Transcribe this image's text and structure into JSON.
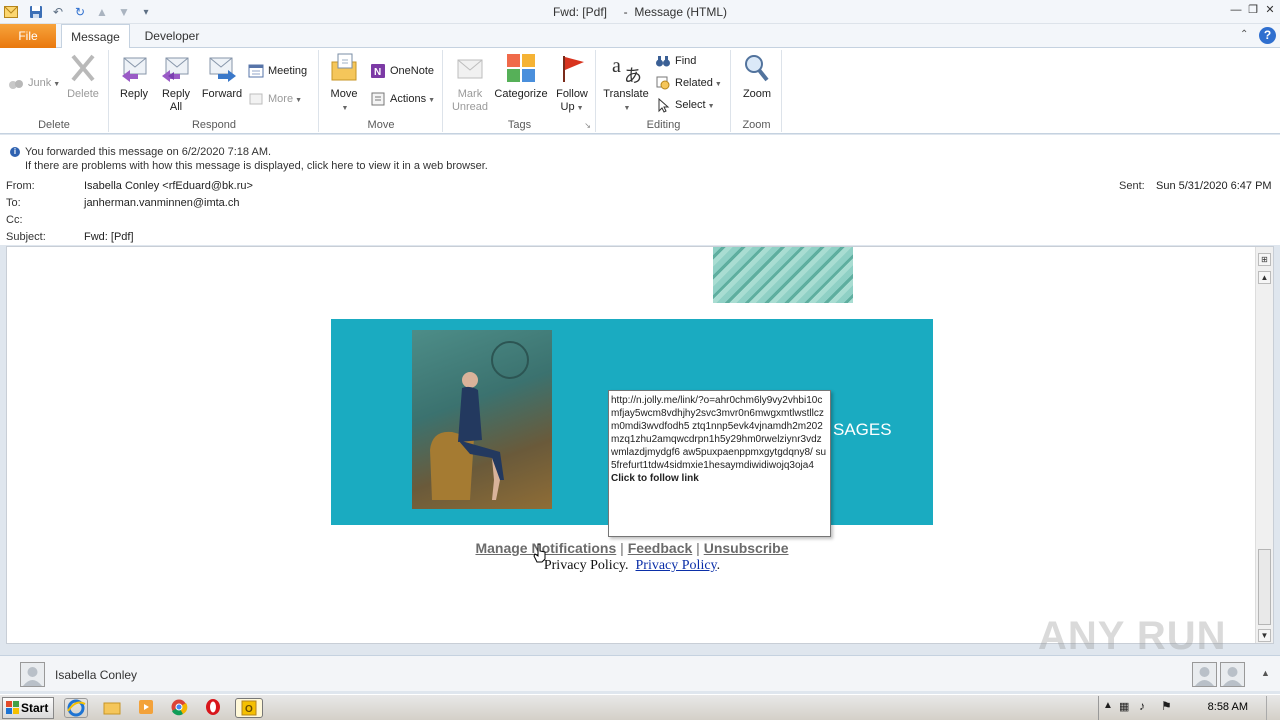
{
  "window": {
    "title": "Fwd: [Pdf]     -  Message (HTML)"
  },
  "tabs": [
    {
      "label": "File"
    },
    {
      "label": "Message"
    },
    {
      "label": "Developer"
    }
  ],
  "ribbon": {
    "groups": {
      "delete": "Delete",
      "respond": "Respond",
      "move": "Move",
      "tags": "Tags",
      "editing": "Editing",
      "zoom": "Zoom"
    },
    "buttons": {
      "junk": "Junk",
      "delete": "Delete",
      "reply": "Reply",
      "reply_all_1": "Reply",
      "reply_all_2": "All",
      "forward": "Forward",
      "meeting": "Meeting",
      "more": "More",
      "move": "Move",
      "onenote": "OneNote",
      "actions": "Actions",
      "mark_unread_1": "Mark",
      "mark_unread_2": "Unread",
      "categorize": "Categorize",
      "follow_up_1": "Follow",
      "follow_up_2": "Up",
      "translate": "Translate",
      "find": "Find",
      "related": "Related",
      "select": "Select",
      "zoom": "Zoom"
    }
  },
  "info": {
    "line1": "You forwarded this message on 6/2/2020 7:18 AM.",
    "line2": "If there are problems with how this message is displayed, click here to view it in a web browser."
  },
  "headers": {
    "from_label": "From:",
    "from_value": "Isabella Conley <rfEduard@bk.ru>",
    "to_label": "To:",
    "to_value": "janherman.vanminnen@imta.ch",
    "cc_label": "Cc:",
    "subject_label": "Subject:",
    "subject_value": "Fwd: [Pdf]",
    "sent_label": "Sent:",
    "sent_value": "Sun 5/31/2020 6:47 PM"
  },
  "mail": {
    "banner_text": "SAGES",
    "footer_links": {
      "manage": "Manage Notifications",
      "sep1": "|",
      "feedback": "Feedback",
      "sep2": "|",
      "unsubscribe": "Unsubscribe"
    },
    "privacy_text": "Privacy Policy.",
    "privacy_link": "Privacy Policy",
    "privacy_end": ".",
    "banner_color": "#1aabc1"
  },
  "tooltip": {
    "url": "http://n.jolly.me/link/?o=ahr0chm6ly9vy2vhbi10cmfjay5wcm8vdhjhy2svc3mvr0n6mwgxmtlwstllczm0mdi3wvdfodh5 ztq1nnp5evk4vjnamdh2m202mzq1zhu2amqwcdrpn1h5y29hm0rwelziynr3vdzwmlazdjmydgf6 aw5puxpaenppmxgytgdqny8/ su5frefurt1tdw4sidmxie1hesaymdiwidiwojq3oja4",
    "hint": "Click to follow link"
  },
  "people": {
    "name": "Isabella Conley"
  },
  "taskbar": {
    "start": "Start",
    "clock": "8:58 AM"
  },
  "watermark": "ANY RUN"
}
